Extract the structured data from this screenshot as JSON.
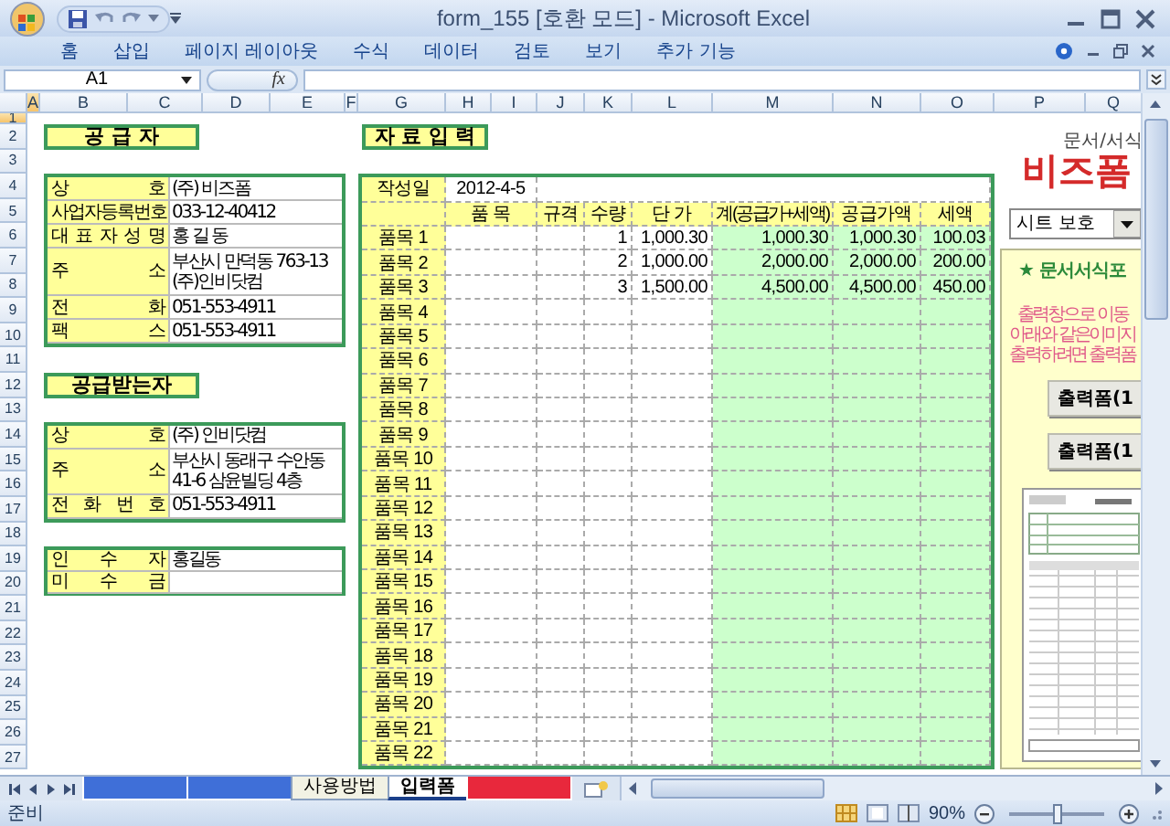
{
  "window": {
    "title": "form_155  [호환 모드] - Microsoft Excel"
  },
  "ribbon_tabs": [
    "홈",
    "삽입",
    "페이지 레이아웃",
    "수식",
    "데이터",
    "검토",
    "보기",
    "추가 기능"
  ],
  "formula_bar": {
    "name_box": "A1",
    "function_label": "fx"
  },
  "columns": [
    {
      "label": "A",
      "selected": true
    },
    {
      "label": "B",
      "selected": false
    },
    {
      "label": "C",
      "selected": false
    },
    {
      "label": "D",
      "selected": false
    },
    {
      "label": "E",
      "selected": false
    },
    {
      "label": "F",
      "selected": false
    },
    {
      "label": "G",
      "selected": false
    },
    {
      "label": "H",
      "selected": false
    },
    {
      "label": "I",
      "selected": false
    },
    {
      "label": "J",
      "selected": false
    },
    {
      "label": "K",
      "selected": false
    },
    {
      "label": "L",
      "selected": false
    },
    {
      "label": "M",
      "selected": false
    },
    {
      "label": "N",
      "selected": false
    },
    {
      "label": "O",
      "selected": false
    },
    {
      "label": "P",
      "selected": false
    },
    {
      "label": "Q",
      "selected": false
    }
  ],
  "rows": [
    {
      "label": "1",
      "selected": true
    },
    {
      "label": "2",
      "selected": false
    },
    {
      "label": "3",
      "selected": false
    },
    {
      "label": "4",
      "selected": false
    },
    {
      "label": "5",
      "selected": false
    },
    {
      "label": "6",
      "selected": false
    },
    {
      "label": "7",
      "selected": false
    },
    {
      "label": "8",
      "selected": false
    },
    {
      "label": "9",
      "selected": false
    },
    {
      "label": "10",
      "selected": false
    },
    {
      "label": "11",
      "selected": false
    },
    {
      "label": "12",
      "selected": false
    },
    {
      "label": "13",
      "selected": false
    },
    {
      "label": "14",
      "selected": false
    },
    {
      "label": "15",
      "selected": false
    },
    {
      "label": "16",
      "selected": false
    },
    {
      "label": "17",
      "selected": false
    },
    {
      "label": "18",
      "selected": false
    },
    {
      "label": "19",
      "selected": false
    },
    {
      "label": "20",
      "selected": false
    },
    {
      "label": "21",
      "selected": false
    },
    {
      "label": "22",
      "selected": false
    },
    {
      "label": "23",
      "selected": false
    },
    {
      "label": "24",
      "selected": false
    },
    {
      "label": "25",
      "selected": false
    },
    {
      "label": "26",
      "selected": false
    },
    {
      "label": "27",
      "selected": false
    }
  ],
  "supplier": {
    "title": "공 급 자",
    "fields": [
      {
        "label": "상 호",
        "value": "(주) 비즈폼"
      },
      {
        "label": "사업자등록번호",
        "value": "033-12-40412"
      },
      {
        "label": "대 표 자 성 명",
        "value": "홍 길 동"
      },
      {
        "label": "주 소",
        "value": "부산시 만덕동 763-13 (주)인비닷컴",
        "kind": "tall"
      },
      {
        "label": "전 화",
        "value": "051-553-4911"
      },
      {
        "label": "팩 스",
        "value": "051-553-4911"
      }
    ]
  },
  "receiver": {
    "title": "공급받는자",
    "fields": [
      {
        "label": "상 호",
        "value": "(주) 인비닷컴"
      },
      {
        "label": "주 소",
        "value": "부산시 동래구 수안동 41-6 삼윤빌딩 4층",
        "kind": "tall"
      },
      {
        "label": "전 화 번 호",
        "value": "051-553-4911"
      }
    ]
  },
  "receipt": {
    "fields": [
      {
        "label": "인 수 자",
        "value": "홍길동"
      },
      {
        "label": "미 수 금"
      }
    ]
  },
  "data_entry": {
    "title": "자 료 입 력",
    "date_label": "작성일",
    "date": "2012-4-5",
    "columns": [
      "품 목",
      "규격",
      "수량",
      "단 가",
      "계(공급가+세액)",
      "공급가액",
      "세액"
    ],
    "items": [
      {
        "label": "품목 1",
        "qty": "1",
        "price": "1,000.30",
        "total": "1,000.30",
        "supply": "1,000.30",
        "tax": "100.03"
      },
      {
        "label": "품목 2",
        "qty": "2",
        "price": "1,000.00",
        "total": "2,000.00",
        "supply": "2,000.00",
        "tax": "200.00"
      },
      {
        "label": "품목 3",
        "qty": "3",
        "price": "1,500.00",
        "total": "4,500.00",
        "supply": "4,500.00",
        "tax": "450.00"
      },
      {
        "label": "품목 4"
      },
      {
        "label": "품목 5"
      },
      {
        "label": "품목 6"
      },
      {
        "label": "품목 7"
      },
      {
        "label": "품목 8"
      },
      {
        "label": "품목 9"
      },
      {
        "label": "품목 10"
      },
      {
        "label": "품목 11"
      },
      {
        "label": "품목 12"
      },
      {
        "label": "품목 13"
      },
      {
        "label": "품목 14"
      },
      {
        "label": "품목 15"
      },
      {
        "label": "품목 16"
      },
      {
        "label": "품목 17"
      },
      {
        "label": "품목 18"
      },
      {
        "label": "품목 19"
      },
      {
        "label": "품목 20"
      },
      {
        "label": "품목 21"
      },
      {
        "label": "품목 22"
      }
    ]
  },
  "side_panel": {
    "logo": "비즈폼",
    "logo_caption": "문서/서식",
    "select": "시트 보호",
    "notice_title": "★ 문서서식포",
    "notice_lines": [
      "출력창으로 이동",
      "아래와 같은이미지",
      "출력하려면 출력폼"
    ],
    "buttons": [
      "출력폼(1",
      "출력폼(1"
    ]
  },
  "sheet_tabs": [
    {
      "color": "#3f6fd8",
      "selected": false
    },
    {
      "color": "#3f6fd8",
      "selected": false
    },
    {
      "label": "사용방법",
      "selected": false
    },
    {
      "label": "입력폼",
      "selected": true
    },
    {
      "color": "#e8283c",
      "selected": false
    }
  ],
  "status_bar": {
    "text": "준비",
    "zoom": "90%",
    "zoom_slider": {
      "level": 0.5
    }
  }
}
